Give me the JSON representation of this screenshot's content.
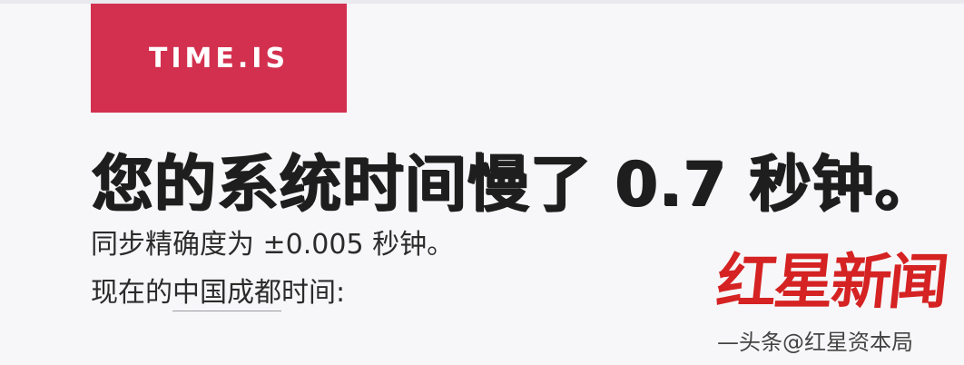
{
  "logo": {
    "text": "TIME.IS"
  },
  "headline": {
    "text": "您的系统时间慢了 0.7 秒钟。"
  },
  "accuracy": {
    "text": "同步精确度为 ±0.005 秒钟。"
  },
  "location": {
    "prefix": "现在的",
    "link": "中国成都",
    "suffix": "时间:"
  },
  "watermark": {
    "text": "红星新闻"
  },
  "credit": {
    "text": "—头条@红星资本局"
  },
  "colors": {
    "brand": "#d3304f",
    "watermark": "#d52222",
    "background": "#f7f7f9"
  }
}
